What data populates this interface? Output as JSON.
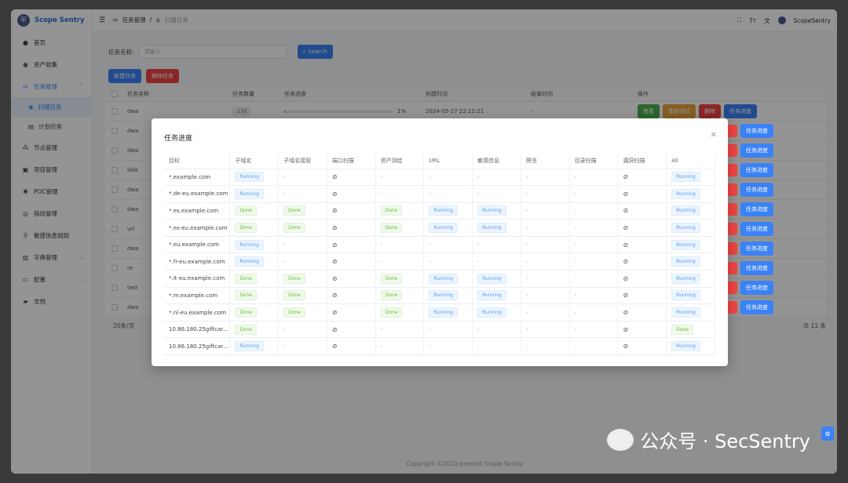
{
  "brand": {
    "name": "Scope Sentry",
    "logo_icon": "shield-logo-icon"
  },
  "sidebar": {
    "items": [
      {
        "label": "首页",
        "icon": "dot-icon"
      },
      {
        "label": "资产收集",
        "icon": "eye-icon"
      },
      {
        "label": "任务管理",
        "icon": "list-icon",
        "open": true
      },
      {
        "label": "扫描任务",
        "icon": "eye-icon",
        "sub": true,
        "active": true
      },
      {
        "label": "计划任务",
        "icon": "calendar-icon",
        "sub": true
      },
      {
        "label": "节点管理",
        "icon": "nodes-icon"
      },
      {
        "label": "项目管理",
        "icon": "folder-icon"
      },
      {
        "label": "POC管理",
        "icon": "bug-icon"
      },
      {
        "label": "指纹管理",
        "icon": "fingerprint-icon"
      },
      {
        "label": "敏感信息规则",
        "icon": "rule-icon"
      },
      {
        "label": "字典管理",
        "icon": "book-icon"
      },
      {
        "label": "配置",
        "icon": "config-icon"
      },
      {
        "label": "文档",
        "icon": "doc-icon"
      }
    ]
  },
  "header": {
    "breadcrumb_parent": "任务管理",
    "breadcrumb_sep": "/",
    "breadcrumb_current": "扫描任务",
    "user": "ScopeSentry"
  },
  "filter": {
    "label": "任务名称:",
    "placeholder": "请输入",
    "search_label": "Search"
  },
  "actions": {
    "new_task": "新建任务",
    "delete_task": "删除任务"
  },
  "main_table": {
    "columns": [
      "任务名称",
      "任务数量",
      "任务进度",
      "创建时间",
      "结束时间",
      "操作"
    ],
    "first_row": {
      "name": "dwa",
      "count": "135",
      "progress_text": "1%",
      "progress_fraction": 0.01,
      "created": "2024-05-27 22:11:21",
      "end": "-"
    },
    "row_names": [
      "dwa",
      "dwa",
      "lkkk",
      "dwa",
      "dwa",
      "url",
      "dwa",
      "re",
      "test",
      "dwa"
    ],
    "row_actions": {
      "view": "查看",
      "retest": "重新测试",
      "delete": "删除",
      "progress": "任务进度"
    },
    "page_size": "20条/页",
    "total": "共 11 条"
  },
  "modal": {
    "title": "任务进度",
    "columns": [
      "目标",
      "子域名",
      "子域名接管",
      "端口扫描",
      "资产测绘",
      "URL",
      "敏感信息",
      "爬虫",
      "目录扫描",
      "漏洞扫描",
      "All"
    ],
    "rows": [
      [
        "*.example.com",
        "Running",
        "-",
        "BAN",
        "-",
        "-",
        "-",
        "-",
        "-",
        "BAN",
        "Running"
      ],
      [
        "*.de-eu.example.com",
        "Running",
        "-",
        "BAN",
        "-",
        "-",
        "-",
        "-",
        "-",
        "BAN",
        "Running"
      ],
      [
        "*.es.example.com",
        "Done",
        "Done",
        "BAN",
        "Done",
        "Running",
        "Running",
        "-",
        "-",
        "BAN",
        "Running"
      ],
      [
        "*.es-eu.example.com",
        "Done",
        "Done",
        "BAN",
        "Done",
        "Running",
        "Running",
        "-",
        "-",
        "BAN",
        "Running"
      ],
      [
        "*.eu.example.com",
        "Running",
        "-",
        "BAN",
        "-",
        "-",
        "-",
        "-",
        "-",
        "BAN",
        "Running"
      ],
      [
        "*.fr-eu.example.com",
        "Running",
        "-",
        "BAN",
        "-",
        "-",
        "-",
        "-",
        "-",
        "BAN",
        "Running"
      ],
      [
        "*.it-eu.example.com",
        "Done",
        "Done",
        "BAN",
        "Done",
        "Running",
        "Running",
        "-",
        "-",
        "BAN",
        "Running"
      ],
      [
        "*.m.example.com",
        "Done",
        "Done",
        "BAN",
        "Done",
        "Running",
        "Running",
        "-",
        "-",
        "BAN",
        "Running"
      ],
      [
        "*.nl-eu.example.com",
        "Done",
        "Done",
        "BAN",
        "Done",
        "Running",
        "Running",
        "-",
        "-",
        "BAN",
        "Running"
      ],
      [
        "10.86.180.25giftcard...",
        "Done",
        "-",
        "BAN",
        "-",
        "-",
        "-",
        "-",
        "-",
        "BAN",
        "Done"
      ],
      [
        "10.86.180.25giftcard...",
        "Running",
        "-",
        "BAN",
        "-",
        "-",
        "-",
        "-",
        "-",
        "BAN",
        "Running"
      ]
    ]
  },
  "footer": {
    "copyright": "Copyright ©2021-present Scope Sentry"
  },
  "watermark": {
    "text": "公众号 · SecSentry"
  },
  "colors": {
    "primary": "#3b82f6",
    "danger": "#ef4444",
    "success": "#4caf50",
    "warning": "#e6a23c",
    "brand": "#2f6bd8"
  }
}
